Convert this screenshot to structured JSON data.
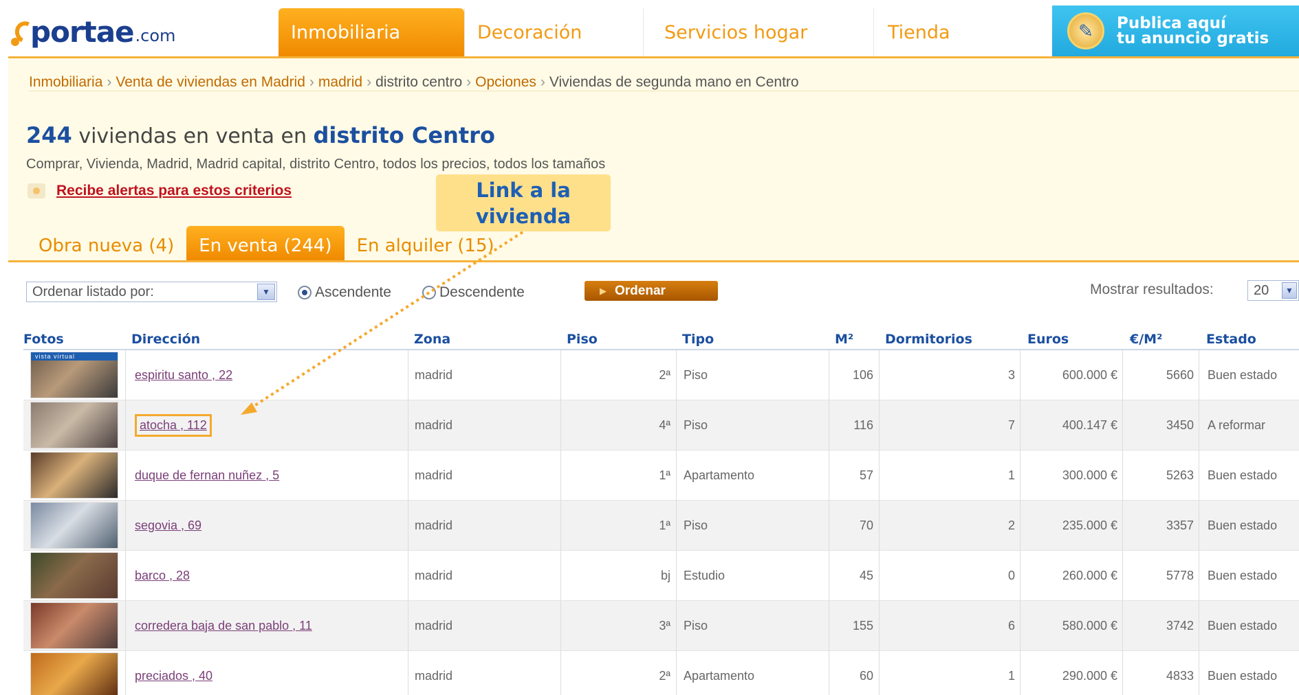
{
  "logo": {
    "text": "portae",
    "suffix": ".com"
  },
  "nav": {
    "tabs": [
      {
        "label": "Inmobiliaria",
        "active": true
      },
      {
        "label": "Decoración",
        "active": false
      },
      {
        "label": "Servicios hogar",
        "active": false
      },
      {
        "label": "Tienda",
        "active": false
      }
    ],
    "publica": {
      "line1": "Publica aquí",
      "line2": "tu anuncio gratis"
    }
  },
  "breadcrumb": [
    {
      "label": "Inmobiliaria",
      "link": true
    },
    {
      "label": "Venta de viviendas en Madrid",
      "link": true
    },
    {
      "label": "madrid",
      "link": true
    },
    {
      "label": "distrito centro",
      "link": false
    },
    {
      "label": "Opciones",
      "link": true
    },
    {
      "label": "Viviendas de segunda mano en Centro",
      "link": false
    }
  ],
  "breadcrumb_separator": "›",
  "heading": {
    "count": "244",
    "middle": " viviendas en venta en ",
    "place": "distrito Centro"
  },
  "criteria": "Comprar, Vivienda, Madrid, Madrid capital, distrito Centro, todos los precios, todos los tamaños",
  "alert_link": "Recibe alertas para estos criterios",
  "callout": {
    "line1": "Link a la",
    "line2": "vivienda"
  },
  "tabs": [
    {
      "label": "Obra nueva (4)",
      "active": false
    },
    {
      "label": "En venta (244)",
      "active": true
    },
    {
      "label": "En alquiler (15)",
      "active": false
    }
  ],
  "sort": {
    "select_value": "Ordenar listado por:",
    "radio_asc": "Ascendente",
    "radio_desc": "Descendente",
    "selected": "Ascendente",
    "button": "Ordenar",
    "mostrar_label": "Mostrar resultados:",
    "mostrar_value": "20"
  },
  "table": {
    "headers": [
      "Fotos",
      "Dirección",
      "Zona",
      "Piso",
      "Tipo",
      "M²",
      "Dormitorios",
      "Euros",
      "€/M²",
      "Estado"
    ],
    "first_photo_badge": "vista virtual",
    "rows": [
      {
        "direccion": "espiritu santo , 22",
        "zona": "madrid",
        "piso": "2ª",
        "tipo": "Piso",
        "m2": "106",
        "dormitorios": "3",
        "euros": "600.000 €",
        "eur_m2": "5660",
        "estado": "Buen estado"
      },
      {
        "direccion": "atocha , 112",
        "zona": "madrid",
        "piso": "4ª",
        "tipo": "Piso",
        "m2": "116",
        "dormitorios": "7",
        "euros": "400.147 €",
        "eur_m2": "3450",
        "estado": "A reformar"
      },
      {
        "direccion": "duque de fernan nuñez , 5",
        "zona": "madrid",
        "piso": "1ª",
        "tipo": "Apartamento",
        "m2": "57",
        "dormitorios": "1",
        "euros": "300.000 €",
        "eur_m2": "5263",
        "estado": "Buen estado"
      },
      {
        "direccion": "segovia , 69",
        "zona": "madrid",
        "piso": "1ª",
        "tipo": "Piso",
        "m2": "70",
        "dormitorios": "2",
        "euros": "235.000 €",
        "eur_m2": "3357",
        "estado": "Buen estado"
      },
      {
        "direccion": "barco , 28",
        "zona": "madrid",
        "piso": "bj",
        "tipo": "Estudio",
        "m2": "45",
        "dormitorios": "0",
        "euros": "260.000 €",
        "eur_m2": "5778",
        "estado": "Buen estado"
      },
      {
        "direccion": "corredera baja de san pablo , 11",
        "zona": "madrid",
        "piso": "3ª",
        "tipo": "Piso",
        "m2": "155",
        "dormitorios": "6",
        "euros": "580.000 €",
        "eur_m2": "3742",
        "estado": "Buen estado"
      },
      {
        "direccion": "preciados , 40",
        "zona": "madrid",
        "piso": "2ª",
        "tipo": "Apartamento",
        "m2": "60",
        "dormitorios": "1",
        "euros": "290.000 €",
        "eur_m2": "4833",
        "estado": "Buen estado"
      }
    ]
  },
  "colors": {
    "brand_orange": "#f29a13",
    "brand_blue": "#1b4fa0",
    "link_purple": "#7a3f78",
    "alert_red": "#c0121f",
    "callout_yellow": "#ffe08a",
    "highlight_border": "#f4a92d"
  }
}
